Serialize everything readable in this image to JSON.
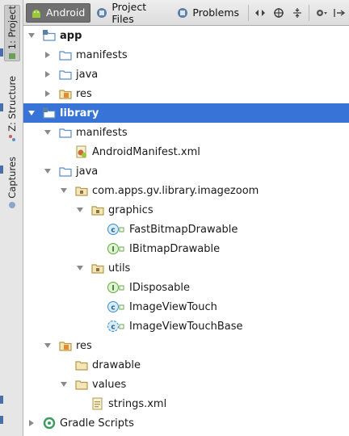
{
  "strip": {
    "tabs": [
      {
        "label": "1: Project",
        "active": true
      },
      {
        "label": "Z: Structure",
        "active": false
      },
      {
        "label": "Captures",
        "active": false
      }
    ]
  },
  "toolbar": {
    "tabs": [
      {
        "label": "Android",
        "icon": "android-icon",
        "active": true
      },
      {
        "label": "Project Files",
        "icon": "project-files-icon",
        "active": false
      },
      {
        "label": "Problems",
        "icon": "problems-icon",
        "active": false
      }
    ],
    "actions": [
      "scroll-arrows-icon",
      "target-icon",
      "collapse-icon",
      "gear-icon",
      "pin-icon"
    ]
  },
  "tree": [
    {
      "label": "app",
      "depth": 0,
      "arrow": "down",
      "icon": "module-folder",
      "bold": true
    },
    {
      "label": "manifests",
      "depth": 1,
      "arrow": "right",
      "icon": "folder"
    },
    {
      "label": "java",
      "depth": 1,
      "arrow": "right",
      "icon": "folder"
    },
    {
      "label": "res",
      "depth": 1,
      "arrow": "right",
      "icon": "res-folder"
    },
    {
      "label": "library",
      "depth": 0,
      "arrow": "down",
      "icon": "module-folder",
      "bold": true,
      "selected": true
    },
    {
      "label": "manifests",
      "depth": 1,
      "arrow": "down",
      "icon": "folder"
    },
    {
      "label": "AndroidManifest.xml",
      "depth": 2,
      "arrow": "none",
      "icon": "xml-manifest"
    },
    {
      "label": "java",
      "depth": 1,
      "arrow": "down",
      "icon": "folder"
    },
    {
      "label": "com.apps.gv.library.imagezoom",
      "depth": 2,
      "arrow": "down",
      "icon": "package"
    },
    {
      "label": "graphics",
      "depth": 3,
      "arrow": "down",
      "icon": "package"
    },
    {
      "label": "FastBitmapDrawable",
      "depth": 4,
      "arrow": "none",
      "icon": "class"
    },
    {
      "label": "IBitmapDrawable",
      "depth": 4,
      "arrow": "none",
      "icon": "interface"
    },
    {
      "label": "utils",
      "depth": 3,
      "arrow": "down",
      "icon": "package"
    },
    {
      "label": "IDisposable",
      "depth": 4,
      "arrow": "none",
      "icon": "interface"
    },
    {
      "label": "ImageViewTouch",
      "depth": 4,
      "arrow": "none",
      "icon": "class"
    },
    {
      "label": "ImageViewTouchBase",
      "depth": 4,
      "arrow": "none",
      "icon": "class-abstract"
    },
    {
      "label": "res",
      "depth": 1,
      "arrow": "down",
      "icon": "res-folder"
    },
    {
      "label": "drawable",
      "depth": 2,
      "arrow": "none",
      "icon": "folder-plain"
    },
    {
      "label": "values",
      "depth": 2,
      "arrow": "down",
      "icon": "folder-plain"
    },
    {
      "label": "strings.xml",
      "depth": 3,
      "arrow": "none",
      "icon": "xml-values"
    },
    {
      "label": "Gradle Scripts",
      "depth": 0,
      "arrow": "right",
      "icon": "gradle"
    }
  ],
  "colors": {
    "selection": "#3874d8",
    "folder": "#5b8fc7",
    "class": "#3a8fc9",
    "interface": "#5fad3d"
  }
}
